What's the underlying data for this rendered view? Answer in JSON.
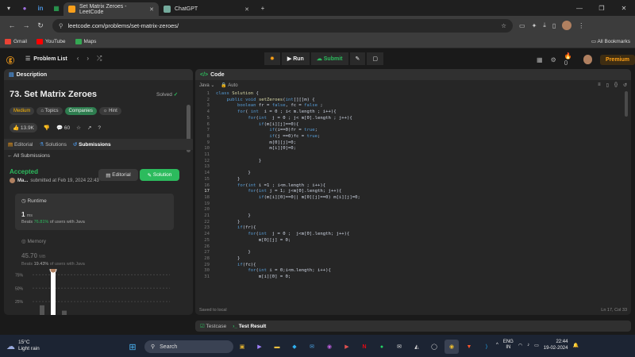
{
  "browser": {
    "tabs": [
      {
        "label": "Set Matrix Zeroes - LeetCode",
        "active": true,
        "favicon_color": "#f89f1b"
      },
      {
        "label": "ChatGPT",
        "active": false,
        "favicon_color": "#74aa9c"
      }
    ],
    "url": "leetcode.com/problems/set-matrix-zeroes/",
    "bookmarks": [
      "Gmail",
      "YouTube",
      "Maps"
    ],
    "all_bookmarks": "All Bookmarks"
  },
  "lcnav": {
    "problem_list": "Problem List",
    "run": "Run",
    "submit": "Submit",
    "fire_count": "0",
    "premium": "Premium"
  },
  "left": {
    "header": "Description",
    "title": "73. Set Matrix Zeroes",
    "solved_label": "Solved",
    "tags": [
      "Medium",
      "Topics",
      "Companies",
      "Hint"
    ],
    "likes": "13.9K",
    "comments": "60",
    "subtabs": [
      "Editorial",
      "Solutions",
      "Submissions"
    ],
    "all_submissions": "All Submissions",
    "status": "Accepted",
    "author": "Ma...",
    "submitted_at": "submitted at Feb 19, 2024 22:43",
    "editorial_btn": "Editorial",
    "solution_btn": "Solution",
    "runtime": {
      "label": "Runtime",
      "value": "1",
      "unit": "ms",
      "beats_prefix": "Beats",
      "beats_pct": "76.81%",
      "beats_suffix": "of users with Java"
    },
    "memory": {
      "label": "Memory",
      "value": "45.70",
      "unit": "MB",
      "beats_prefix": "Beats",
      "beats_pct": "19.43%",
      "beats_suffix": "of users with Java"
    }
  },
  "chart_data": {
    "type": "bar",
    "title": "",
    "ytick_labels": [
      "75%",
      "50%",
      "25%"
    ],
    "y_ticks": [
      75,
      50,
      25
    ],
    "ylim": [
      0,
      80
    ],
    "bars": [
      {
        "value": 18,
        "highlight": false
      },
      {
        "value": 80,
        "highlight": true
      },
      {
        "value": 8,
        "highlight": false
      }
    ]
  },
  "code": {
    "header": "Code",
    "language": "Java",
    "mode": "Auto",
    "current_line": 17,
    "lines": [
      "class Solution {",
      "    public void setZeroes(int[][]m) {",
      "        boolean fr = false, fc = false ;",
      "        for( int  i = 0 ; i< m.length ; i++){",
      "            for(int  j = 0 ; j< m[0].length ; j++){",
      "                if(m[i][j]==0){",
      "                    if(i==0)fr = true;",
      "                    if(j ==0)fc = true;",
      "                    m[0][j]=0;",
      "                    m[i][0]=0;",
      "",
      "                }",
      "",
      "            }",
      "        }",
      "        for(int i =1 ; i<m.length ; i++){",
      "            for(int j = 1; j<m[0].length; j++){",
      "                if(m[i][0]==0|| m[0][j]==0) m[i][j]=0;",
      "",
      "",
      "            }",
      "        }",
      "        if(fr){",
      "            for(int  j = 0 ;  j<m[0].length; j++){",
      "                m[0][j] = 0;",
      "",
      "            }",
      "        }",
      "        if(fc){",
      "            for(int i = 0;i<m.length; i++){",
      "                m[i][0] = 0;"
    ],
    "saved": "Saved to local",
    "position": "Ln 17, Col 33"
  },
  "bottom": {
    "testcase": "Testcase",
    "result": "Test Result"
  },
  "taskbar": {
    "temp": "15°C",
    "weather": "Light rain",
    "search": "Search",
    "lang1": "ENG",
    "lang2": "IN",
    "time": "22:44",
    "date": "19-02-2024"
  }
}
